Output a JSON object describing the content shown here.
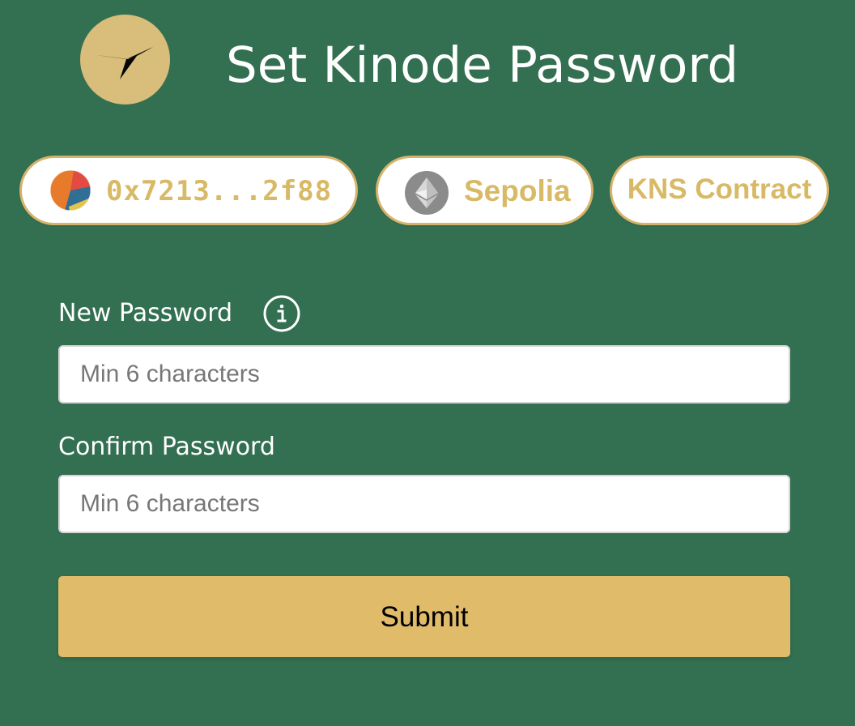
{
  "colors": {
    "background": "#336f51",
    "gold": "#d8b965",
    "white": "#ffffff",
    "button": "#dfbb6a"
  },
  "header": {
    "logo_icon": "kinode-bird-icon",
    "title": "Set Kinode Password"
  },
  "status_pills": {
    "wallet": {
      "avatar_icon": "wallet-avatar-icon",
      "address": "0x7213...2f88"
    },
    "network": {
      "icon": "ethereum-icon",
      "label": "Sepolia"
    },
    "contract": {
      "label": "KNS Contract"
    }
  },
  "form": {
    "new_password": {
      "label": "New Password",
      "info_icon": "info-icon",
      "placeholder": "Min 6 characters",
      "value": ""
    },
    "confirm_password": {
      "label": "Confirm Password",
      "placeholder": "Min 6 characters",
      "value": ""
    },
    "submit_label": "Submit"
  }
}
